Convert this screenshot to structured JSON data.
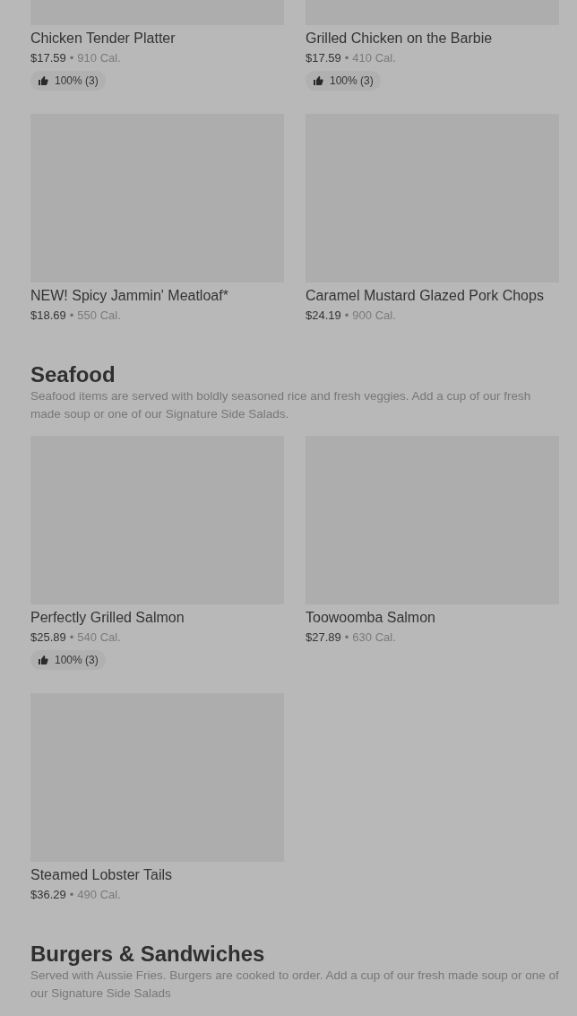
{
  "sections": [
    {
      "items": [
        {
          "name": "Chicken Tender Platter",
          "price": "$17.59",
          "separator": "•",
          "calories": "910 Cal.",
          "rating": "100% (3)"
        },
        {
          "name": "Grilled Chicken on the Barbie",
          "price": "$17.59",
          "separator": "•",
          "calories": "410 Cal.",
          "rating": "100% (3)"
        },
        {
          "name": "NEW! Spicy Jammin' Meatloaf*",
          "price": "$18.69",
          "separator": "•",
          "calories": "550 Cal."
        },
        {
          "name": "Caramel Mustard Glazed Pork Chops",
          "price": "$24.19",
          "separator": "•",
          "calories": "900 Cal."
        }
      ]
    },
    {
      "title": "Seafood",
      "description": "Seafood items are served with boldly seasoned rice and fresh veggies. Add a cup of our fresh made soup or one of our Signature Side Salads.",
      "items": [
        {
          "name": "Perfectly Grilled Salmon",
          "price": "$25.89",
          "separator": "•",
          "calories": "540 Cal.",
          "rating": "100% (3)"
        },
        {
          "name": "Toowoomba Salmon",
          "price": "$27.89",
          "separator": "•",
          "calories": "630 Cal."
        },
        {
          "name": "Steamed Lobster Tails",
          "price": "$36.29",
          "separator": "•",
          "calories": "490 Cal."
        }
      ]
    },
    {
      "title": "Burgers & Sandwiches",
      "description": "Served with Aussie Fries. Burgers are cooked to order. Add a cup of our fresh made soup or one of our Signature Side Salads"
    }
  ]
}
